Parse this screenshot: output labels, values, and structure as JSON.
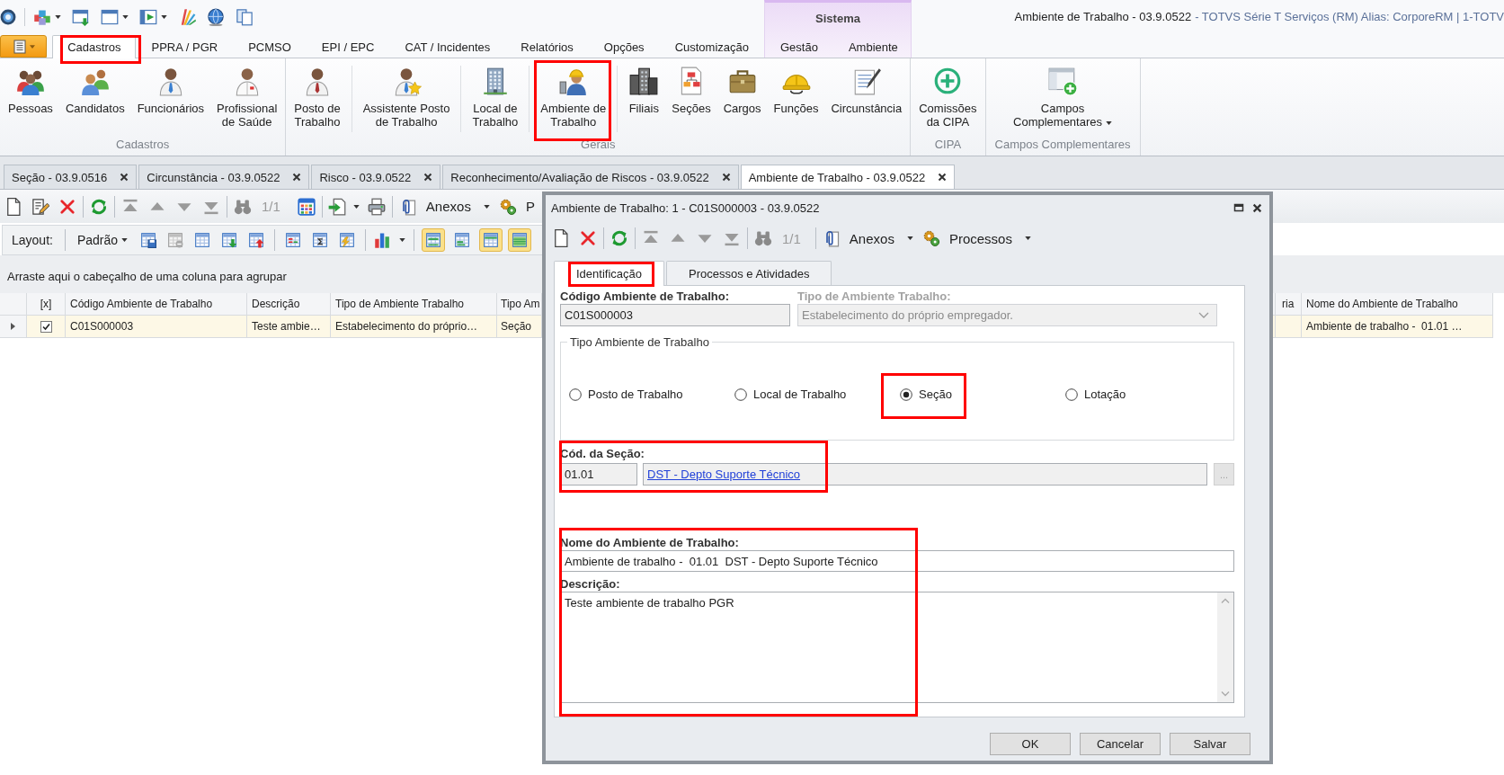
{
  "window": {
    "title": "Ambiente de Trabalho - 03.9.0522",
    "subtitle": "- TOTVS Série T Serviços (RM) Alias: CorporeRM | 1-TOTV"
  },
  "ribbon": {
    "tabs": [
      {
        "label": "Cadastros",
        "selected": true,
        "highlighted": true
      },
      {
        "label": "PPRA / PGR",
        "selected": false,
        "highlighted": false
      },
      {
        "label": "PCMSO",
        "selected": false,
        "highlighted": false
      },
      {
        "label": "EPI / EPC",
        "selected": false,
        "highlighted": false
      },
      {
        "label": "CAT / Incidentes",
        "selected": false,
        "highlighted": false
      },
      {
        "label": "Relatórios",
        "selected": false,
        "highlighted": false
      },
      {
        "label": "Opções",
        "selected": false,
        "highlighted": false
      },
      {
        "label": "Customização",
        "selected": false,
        "highlighted": false
      }
    ],
    "context_group": {
      "label": "Sistema",
      "tabs": [
        {
          "label": "Gestão",
          "selected": false
        },
        {
          "label": "Ambiente",
          "selected": false
        }
      ]
    },
    "groups": [
      {
        "label": "Cadastros",
        "buttons": [
          {
            "label": "Pessoas",
            "dropdown": false,
            "highlighted": false
          },
          {
            "label": "Candidatos",
            "dropdown": false,
            "highlighted": false
          },
          {
            "label": "Funcionários",
            "dropdown": false,
            "highlighted": false
          },
          {
            "label": "Profissional\nde Saúde",
            "dropdown": false,
            "highlighted": false
          }
        ]
      },
      {
        "label": "Gerais",
        "buttons": [
          {
            "label": "Posto de\nTrabalho",
            "dropdown": false,
            "highlighted": false
          },
          {
            "label": "Assistente Posto\nde Trabalho",
            "dropdown": false,
            "highlighted": false
          },
          {
            "label": "Local de\nTrabalho",
            "dropdown": false,
            "highlighted": false
          },
          {
            "label": "Ambiente de\nTrabalho",
            "dropdown": false,
            "highlighted": true
          },
          {
            "label": "Filiais",
            "dropdown": false,
            "highlighted": false
          },
          {
            "label": "Seções",
            "dropdown": false,
            "highlighted": false
          },
          {
            "label": "Cargos",
            "dropdown": false,
            "highlighted": false
          },
          {
            "label": "Funções",
            "dropdown": false,
            "highlighted": false
          },
          {
            "label": "Circunstância",
            "dropdown": false,
            "highlighted": false
          }
        ]
      },
      {
        "label": "CIPA",
        "buttons": [
          {
            "label": "Comissões\nda CIPA",
            "dropdown": false,
            "highlighted": false
          }
        ]
      },
      {
        "label": "Campos Complementares",
        "buttons": [
          {
            "label": "Campos\nComplementares",
            "dropdown": true,
            "highlighted": false
          }
        ]
      }
    ]
  },
  "doc_tabs": [
    {
      "label": "Seção - 03.9.0516",
      "selected": false
    },
    {
      "label": "Circunstância - 03.9.0522",
      "selected": false
    },
    {
      "label": "Risco - 03.9.0522",
      "selected": false
    },
    {
      "label": "Reconhecimento/Avaliação de Riscos - 03.9.0522",
      "selected": false
    },
    {
      "label": "Ambiente de Trabalho - 03.9.0522",
      "selected": true
    }
  ],
  "toolbar": {
    "record_counter": "1/1",
    "attachments": {
      "label": "Anexos",
      "dropdown": true
    },
    "processes": {
      "label": "P",
      "dropdown": false
    }
  },
  "layout_bar": {
    "label": "Layout:",
    "preset": {
      "label": "Padrão",
      "dropdown": true
    },
    "view_toggles": [
      {
        "selected": true
      },
      {
        "selected": false
      },
      {
        "selected": true
      },
      {
        "selected": true
      }
    ]
  },
  "grid": {
    "group_hint": "Arraste aqui o cabeçalho de uma coluna para agrupar",
    "columns": [
      "[x]",
      "Código Ambiente de Trabalho",
      "Descrição",
      "Tipo de Ambiente Trabalho",
      "Tipo Am",
      "ria",
      "Nome do Ambiente de Trabalho"
    ],
    "rows": [
      {
        "selected": true,
        "checked": true,
        "cells": [
          "",
          "C01S000003",
          "Teste ambie…",
          "Estabelecimento do próprio…",
          "Seção",
          "",
          "Ambiente de trabalho -  01.01 …"
        ]
      }
    ]
  },
  "dialog": {
    "title": "Ambiente de Trabalho: 1 - C01S000003 - 03.9.0522",
    "toolbar": {
      "record_counter": "1/1",
      "attachments": {
        "label": "Anexos",
        "dropdown": true
      },
      "processes": {
        "label": "Processos",
        "dropdown": true
      }
    },
    "tabs": [
      {
        "label": "Identificação",
        "selected": true,
        "highlighted": true
      },
      {
        "label": "Processos e Atividades",
        "selected": false,
        "highlighted": false
      }
    ],
    "form": {
      "code": {
        "label": "Código Ambiente de Trabalho:",
        "value": "C01S000003"
      },
      "environment_type": {
        "label": "Tipo de Ambiente Trabalho:",
        "value": "Estabelecimento do próprio empregador.",
        "disabled": true
      },
      "type_group": {
        "title": "Tipo Ambiente de Trabalho",
        "options": [
          {
            "label": "Posto de Trabalho",
            "selected": false,
            "highlighted": false
          },
          {
            "label": "Local de Trabalho",
            "selected": false,
            "highlighted": false
          },
          {
            "label": "Seção",
            "selected": true,
            "highlighted": true
          },
          {
            "label": "Lotação",
            "selected": false,
            "highlighted": false
          }
        ]
      },
      "section": {
        "label": "Cód. da Seção:",
        "code": "01.01",
        "link": "DST - Depto Suporte Técnico",
        "lookup": {
          "label": "...",
          "disabled": true
        },
        "highlighted": true
      },
      "details": {
        "highlighted": true,
        "name": {
          "label": "Nome do Ambiente de Trabalho:",
          "value": "Ambiente de trabalho -  01.01  DST - Depto Suporte Técnico"
        },
        "description": {
          "label": "Descrição:",
          "value": "Teste ambiente de trabalho PGR"
        }
      }
    },
    "buttons": [
      "OK",
      "Cancelar",
      "Salvar"
    ]
  }
}
